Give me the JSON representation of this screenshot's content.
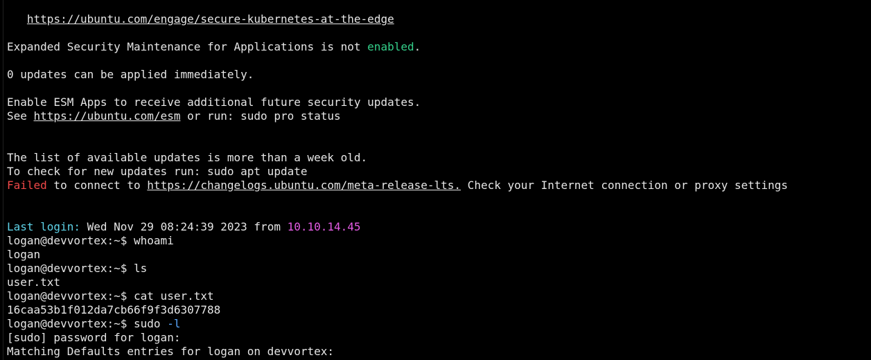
{
  "terminal": {
    "lines": [
      {
        "segments": [
          {
            "text": "   "
          },
          {
            "text": "https://ubuntu.com/engage/secure-kubernetes-at-the-edge",
            "style": "link"
          }
        ]
      },
      {
        "segments": []
      },
      {
        "segments": [
          {
            "text": "Expanded Security Maintenance for Applications is not "
          },
          {
            "text": "enabled",
            "style": "green"
          },
          {
            "text": "."
          }
        ]
      },
      {
        "segments": []
      },
      {
        "segments": [
          {
            "text": "0 updates can be applied immediately."
          }
        ]
      },
      {
        "segments": []
      },
      {
        "segments": [
          {
            "text": "Enable ESM Apps to receive additional future security updates."
          }
        ]
      },
      {
        "segments": [
          {
            "text": "See "
          },
          {
            "text": "https://ubuntu.com/esm",
            "style": "link"
          },
          {
            "text": " or run: sudo pro status"
          }
        ]
      },
      {
        "segments": []
      },
      {
        "segments": []
      },
      {
        "segments": [
          {
            "text": "The list of available updates is more than a week old."
          }
        ]
      },
      {
        "segments": [
          {
            "text": "To check for new updates run: sudo apt update"
          }
        ]
      },
      {
        "segments": [
          {
            "text": "Failed",
            "style": "red"
          },
          {
            "text": " to connect to "
          },
          {
            "text": "https://changelogs.ubuntu.com/meta-release-lts.",
            "style": "link"
          },
          {
            "text": " Check your Internet connection or proxy settings"
          }
        ]
      },
      {
        "segments": []
      },
      {
        "segments": []
      },
      {
        "segments": [
          {
            "text": "Last login:",
            "style": "cyan"
          },
          {
            "text": " Wed Nov 29 08:24:39 2023 from "
          },
          {
            "text": "10.10.14.45",
            "style": "magenta"
          }
        ]
      },
      {
        "segments": [
          {
            "text": "logan@devvortex:~$ whoami"
          }
        ]
      },
      {
        "segments": [
          {
            "text": "logan"
          }
        ]
      },
      {
        "segments": [
          {
            "text": "logan@devvortex:~$ ls"
          }
        ]
      },
      {
        "segments": [
          {
            "text": "user.txt"
          }
        ]
      },
      {
        "segments": [
          {
            "text": "logan@devvortex:~$ cat user.txt"
          }
        ]
      },
      {
        "segments": [
          {
            "text": "16caa53b1f012da7cb66f9f3d6307788"
          }
        ]
      },
      {
        "segments": [
          {
            "text": "logan@devvortex:~$ sudo "
          },
          {
            "text": "-l",
            "style": "blue"
          }
        ]
      },
      {
        "segments": [
          {
            "text": "[sudo] password for logan:"
          }
        ]
      },
      {
        "segments": [
          {
            "text": "Matching Defaults entries for logan on devvortex:"
          }
        ]
      }
    ]
  },
  "colors": {
    "background": "#000000",
    "foreground": "#e6e6e6",
    "green": "#34d18b",
    "red": "#f04848",
    "cyan": "#5fd3e8",
    "magenta": "#e65ce6",
    "blue": "#5aa8ff"
  }
}
